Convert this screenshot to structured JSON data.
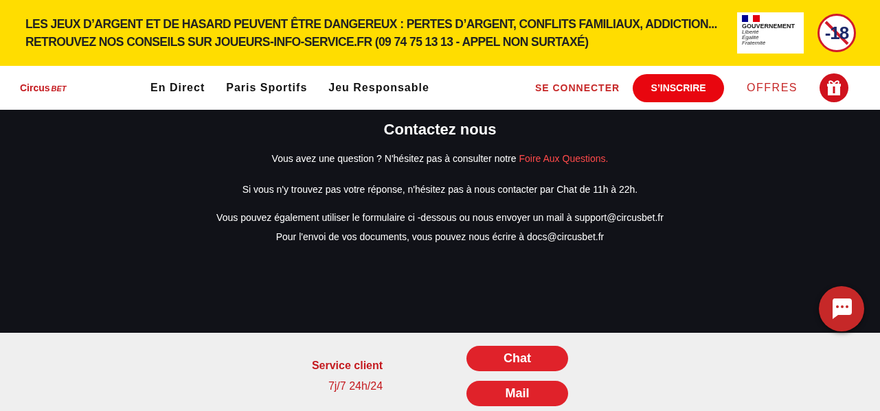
{
  "warning_banner": {
    "lines": [
      "LES JEUX D’ARGENT ET DE HASARD PEUVENT ÊTRE DANGEREUX : PERTES D’ARGENT, CONFLITS FAMILIAUX, ADDICTION...",
      "RETROUVEZ NOS CONSEILS SUR JOUEURS-INFO-SERVICE.FR (09 74 75 13 13 - APPEL NON SURTAXÉ)"
    ],
    "gov_logo": {
      "title": "GOUVERNEMENT",
      "motto": [
        "Liberté",
        "Égalité",
        "Fraternité"
      ]
    },
    "age_badge": "-18"
  },
  "navbar": {
    "logo": {
      "main": "Circus",
      "accent": "BET"
    },
    "links": [
      "En Direct",
      "Paris Sportifs",
      "Jeu Responsable"
    ],
    "login": "SE CONNECTER",
    "signup": "S’INSCRIRE",
    "offers": "OFFRES"
  },
  "contact": {
    "title": "Contactez nous",
    "paragraphs": [
      {
        "text": "Vous avez une question ? N'hésitez pas à consulter notre ",
        "link": "Foire Aux Questions."
      },
      {
        "text": "Si vous n'y trouvez pas votre réponse, n'hésitez pas à nous contacter par Chat de 11h à 22h."
      },
      {
        "text": "Vous pouvez également utiliser le formulaire ci -dessous ou nous envoyer un mail à support@circusbet.fr"
      },
      {
        "text": "Pour l'envoi de vos documents, vous pouvez nous écrire à docs@circusbet.fr"
      }
    ]
  },
  "service": {
    "label": "Service client",
    "hours": "7j/7 24h/24",
    "buttons": [
      "Chat",
      "Mail"
    ]
  }
}
